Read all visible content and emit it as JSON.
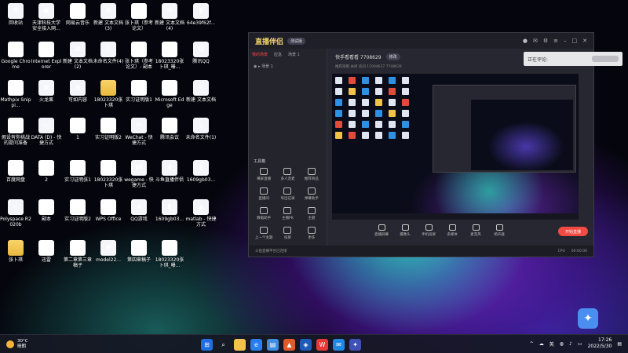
{
  "desktop": {
    "icons": [
      {
        "label": "回收站",
        "glyph": "♻",
        "cls": "doc",
        "icon": "recycle-bin-icon"
      },
      {
        "label": "天津科技大学安全接入网...",
        "glyph": "◆",
        "cls": "doc",
        "icon": "vpn-icon"
      },
      {
        "label": "网易云音乐",
        "glyph": "♪",
        "cls": "doc-p",
        "icon": "netease-music-icon"
      },
      {
        "label": "新建 文本文档 (3)",
        "glyph": "≡",
        "cls": "doc",
        "icon": "text-doc-icon"
      },
      {
        "label": "张卜琪（参考论文）",
        "glyph": "W",
        "cls": "doc-w",
        "icon": "word-doc-icon"
      },
      {
        "label": "新建 文本文档 (4)",
        "glyph": "≡",
        "cls": "doc",
        "icon": "text-doc-icon"
      },
      {
        "label": "64e39f62f...",
        "glyph": "▮",
        "cls": "doc",
        "icon": "image-file-icon"
      },
      {
        "label": "Google Chrome",
        "glyph": "◉",
        "cls": "doc-p",
        "icon": "chrome-icon"
      },
      {
        "label": "Internet Explorer",
        "glyph": "e",
        "cls": "doc-w",
        "icon": "ie-icon"
      },
      {
        "label": "新建 文本文档 (2)",
        "glyph": "≡",
        "cls": "doc",
        "icon": "text-doc-icon"
      },
      {
        "label": "未命名文件(4)",
        "glyph": "◇",
        "cls": "doc",
        "icon": "file-icon"
      },
      {
        "label": "张卜琪（参考论文）- 副本",
        "glyph": "W",
        "cls": "doc-w",
        "icon": "word-doc-icon"
      },
      {
        "label": "18023320张卜琪_曝...",
        "glyph": "P",
        "cls": "doc-p",
        "icon": "pdf-icon"
      },
      {
        "label": "腾讯QQ",
        "glyph": "Q",
        "cls": "doc",
        "icon": "qq-icon"
      },
      {
        "label": "Mathpix Snippi...",
        "glyph": "M",
        "cls": "doc-w",
        "icon": "mathpix-icon"
      },
      {
        "label": "火龙果",
        "glyph": "≡",
        "cls": "doc",
        "icon": "text-doc-icon"
      },
      {
        "label": "可如内容",
        "glyph": "≡",
        "cls": "doc",
        "icon": "text-doc-icon"
      },
      {
        "label": "18023320张卜琪",
        "glyph": "",
        "cls": "folder",
        "icon": "folder-icon"
      },
      {
        "label": "实习证明版1",
        "glyph": "W",
        "cls": "doc-w",
        "icon": "word-doc-icon"
      },
      {
        "label": "Microsoft Edge",
        "glyph": "e",
        "cls": "doc-w",
        "icon": "edge-icon"
      },
      {
        "label": "新建 文本文档",
        "glyph": "≡",
        "cls": "doc",
        "icon": "text-doc-icon"
      },
      {
        "label": "假设有你挑战的提问准备",
        "glyph": "W",
        "cls": "doc-w",
        "icon": "word-doc-icon"
      },
      {
        "label": "DATA (D) - 快捷方式",
        "glyph": "▭",
        "cls": "doc",
        "icon": "drive-icon"
      },
      {
        "label": "1",
        "glyph": "P",
        "cls": "doc-p",
        "icon": "pdf-icon"
      },
      {
        "label": "实习证明版2",
        "glyph": "W",
        "cls": "doc-w",
        "icon": "word-doc-icon"
      },
      {
        "label": "WeChat - 快捷方式",
        "glyph": "✉",
        "cls": "doc",
        "icon": "wechat-icon"
      },
      {
        "label": "腾讯会议",
        "glyph": "◈",
        "cls": "doc-w",
        "icon": "tencent-meeting-icon"
      },
      {
        "label": "未命名文件(1)",
        "glyph": "◇",
        "cls": "doc",
        "icon": "file-icon"
      },
      {
        "label": "百度网盘",
        "glyph": "☁",
        "cls": "doc-w",
        "icon": "baidu-netdisk-icon"
      },
      {
        "label": "2",
        "glyph": "P",
        "cls": "doc-p",
        "icon": "pdf-icon"
      },
      {
        "label": "实习证明张1",
        "glyph": "W",
        "cls": "doc-w",
        "icon": "word-doc-icon"
      },
      {
        "label": "18023320张卜琪",
        "glyph": "P",
        "cls": "doc-p",
        "icon": "ppt-icon"
      },
      {
        "label": "wegame - 快捷方式",
        "glyph": "W",
        "cls": "doc",
        "icon": "wegame-icon"
      },
      {
        "label": "斗鱼直播伴侣",
        "glyph": "◉",
        "cls": "doc",
        "icon": "douyu-icon"
      },
      {
        "label": "1609gb03...",
        "glyph": "▮",
        "cls": "doc",
        "icon": "image-file-icon"
      },
      {
        "label": "Polyspace R2020b",
        "glyph": "✓",
        "cls": "doc",
        "icon": "polyspace-icon"
      },
      {
        "label": "副本",
        "glyph": "W",
        "cls": "doc-w",
        "icon": "word-doc-icon"
      },
      {
        "label": "实习证明版2",
        "glyph": "W",
        "cls": "doc-w",
        "icon": "word-doc-icon"
      },
      {
        "label": "WPS Office",
        "glyph": "W",
        "cls": "doc-p",
        "icon": "wps-icon"
      },
      {
        "label": "QQ游戏",
        "glyph": "◈",
        "cls": "doc",
        "icon": "qq-game-icon"
      },
      {
        "label": "1609gb03...",
        "glyph": "▮",
        "cls": "doc",
        "icon": "image-file-icon"
      },
      {
        "label": "matlab - 快捷方式",
        "glyph": "▲",
        "cls": "doc",
        "icon": "matlab-icon"
      },
      {
        "label": "张卜琪",
        "glyph": "",
        "cls": "folder",
        "icon": "folder-icon"
      },
      {
        "label": "迅雷",
        "glyph": "✦",
        "cls": "doc-w",
        "icon": "xunlei-icon"
      },
      {
        "label": "第二章第三章稿子",
        "glyph": "W",
        "cls": "doc-w",
        "icon": "word-doc-icon"
      },
      {
        "label": "model22...",
        "glyph": "≡",
        "cls": "doc",
        "icon": "text-doc-icon"
      },
      {
        "label": "第四章稿子",
        "glyph": "W",
        "cls": "doc-w",
        "icon": "word-doc-icon"
      },
      {
        "label": "18023320张卜琪_曝...",
        "glyph": "W",
        "cls": "doc-w",
        "icon": "word-doc-icon"
      }
    ]
  },
  "app": {
    "title": "直播伴侣",
    "version_badge": "测试版",
    "tabs": [
      "我的场景",
      "应急",
      "场景 1"
    ],
    "scene_label": "场景 1",
    "room_title": "快手看看看 7708629",
    "room_tag": "修改",
    "room_sub": "推荐观看  关闭   房间 11004637   7708629",
    "tool_title": "工具箱",
    "tools": [
      "横屏直播",
      "多人连麦",
      "推荐商品",
      "直播间",
      "导出记录",
      "弹幕助手",
      "数据助手",
      "主播PK",
      "主题",
      "上一个主题",
      "投屏",
      "更多"
    ],
    "controls": [
      "直播屏幕",
      "摄像头",
      "手机投屏",
      "多媒体",
      "麦克风",
      "扬声器"
    ],
    "start_live": "开始直播",
    "status_left": "斗鱼直播平台已连接",
    "status_right": [
      "CPU",
      "00:00:00"
    ],
    "comment_label": "正在评论:"
  },
  "taskbar": {
    "weather_temp": "30°C",
    "weather_desc": "晴朗",
    "lang": "英",
    "time": "17:26",
    "date": "2022/5/30"
  }
}
